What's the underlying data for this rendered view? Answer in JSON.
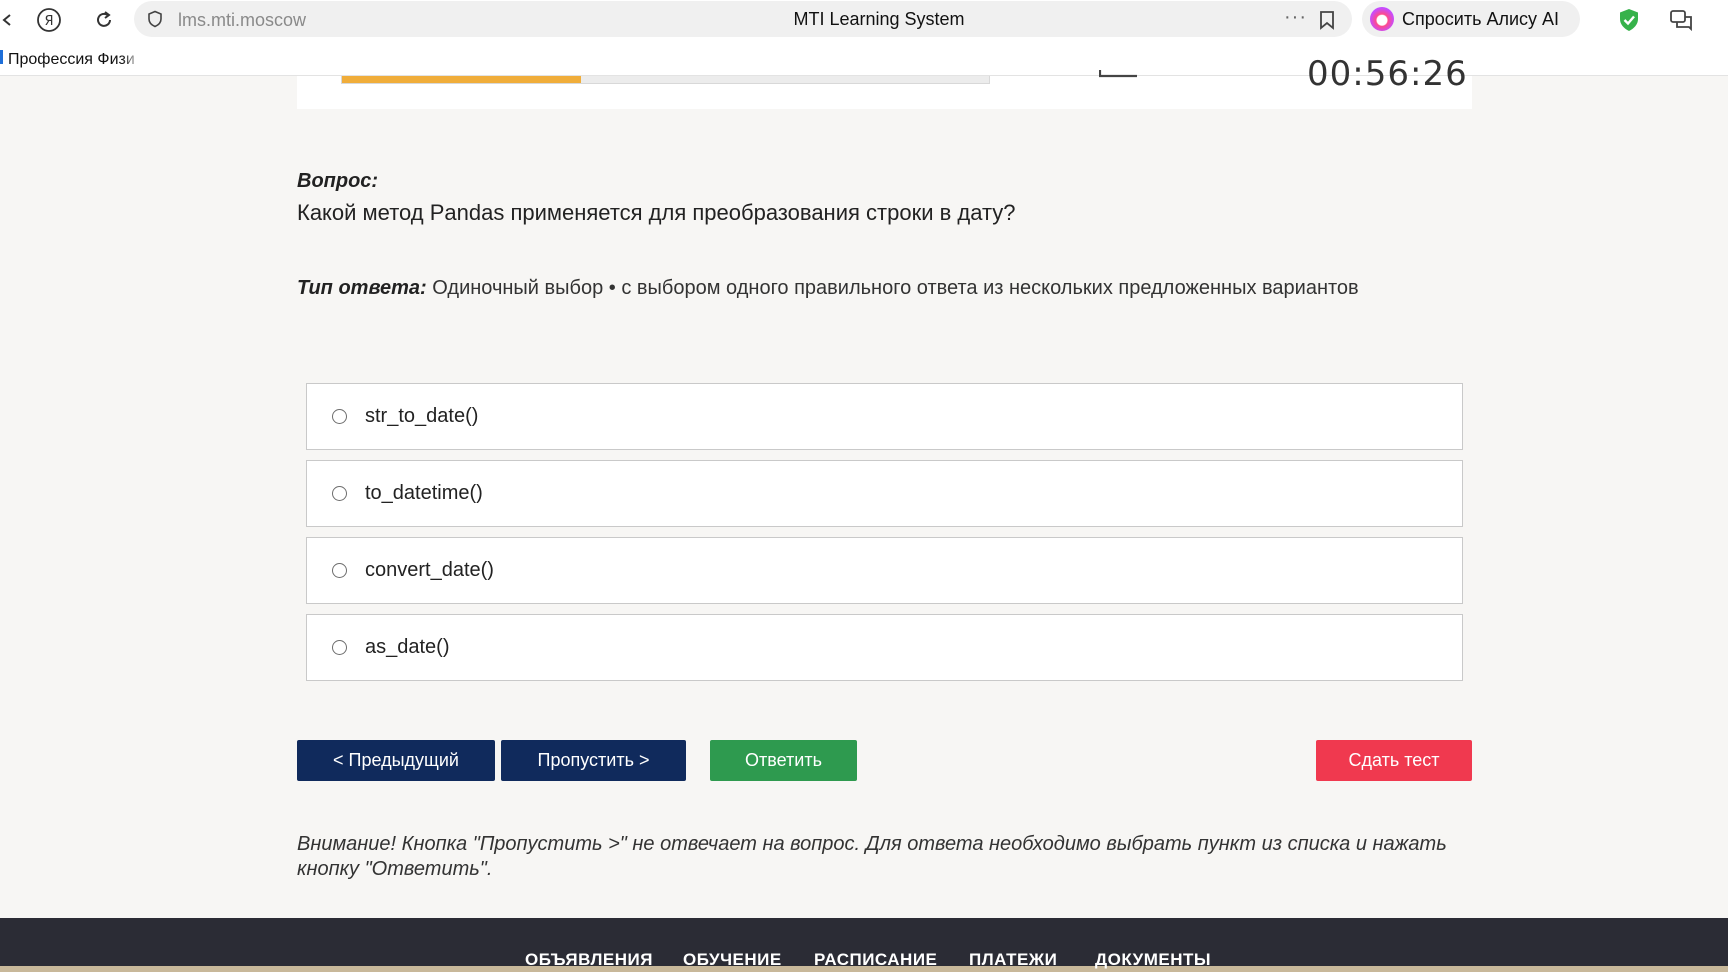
{
  "browser": {
    "url": "lms.mti.moscow",
    "tab_title": "MTI Learning System",
    "alice_label": "Спросить Алису AI",
    "dots": "···",
    "bookmark_label": "Профессия Физи"
  },
  "header": {
    "progress_fraction": 0.37,
    "timer_text": "00:56:26"
  },
  "question": {
    "label": "Вопрос:",
    "text": "Какой метод Pandas применяется для преобразования строки в дату?",
    "type_label": "Тип ответа:",
    "type_value": "Одиночный выбор • с выбором одного правильного ответа из нескольких предложенных вариантов"
  },
  "options": [
    {
      "label": "str_to_date()"
    },
    {
      "label": "to_datetime()"
    },
    {
      "label": "convert_date()"
    },
    {
      "label": "as_date()"
    }
  ],
  "buttons": {
    "prev": "< Предыдущий",
    "skip": "Пропустить >",
    "answer": "Ответить",
    "submit": "Сдать тест"
  },
  "notice": "Внимание! Кнопка \"Пропустить >\" не отвечает на вопрос. Для ответа необходимо выбрать пункт из списка и нажать кнопку \"Ответить\".",
  "footer_nav": [
    "ОБЪЯВЛЕНИЯ",
    "ОБУЧЕНИЕ",
    "РАСПИСАНИЕ",
    "ПЛАТЕЖИ",
    "ДОКУМЕНТЫ"
  ],
  "colors": {
    "progress": "#f0ad3a",
    "primary_button": "#102a5c",
    "answer_button": "#2e9a4f",
    "submit_button": "#f0394f",
    "footer": "#2b2c35"
  }
}
